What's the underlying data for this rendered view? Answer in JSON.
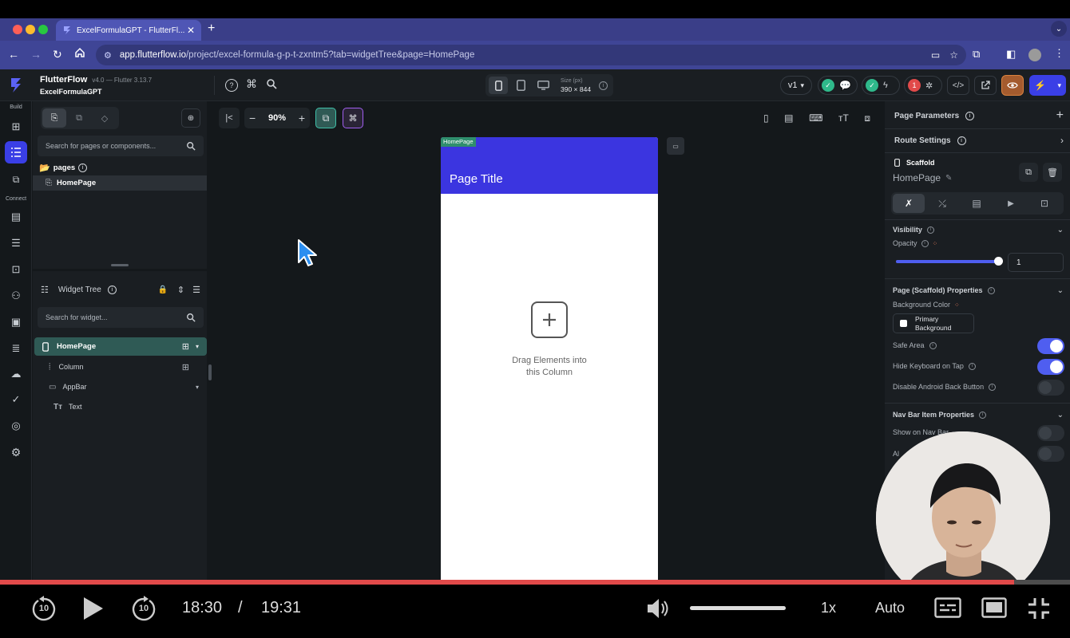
{
  "browser": {
    "tab_title": "ExcelFormulaGPT - FlutterFl...",
    "url_prefix": "app.flutterflow.io",
    "url_rest": "/project/excel-formula-g-p-t-zxntm5?tab=widgetTree&page=HomePage"
  },
  "header": {
    "app_name": "FlutterFlow",
    "version": "v4.0 — Flutter 3.13.7",
    "project": "ExcelFormulaGPT",
    "size_label": "Size (px)",
    "size_value": "390 × 844",
    "version_select": "v1",
    "error_count": "1"
  },
  "leftrail": {
    "build": "Build",
    "connect": "Connect"
  },
  "pages_panel": {
    "search_placeholder": "Search for pages or components...",
    "pages_label": "pages",
    "page_item": "HomePage"
  },
  "widget_tree": {
    "title": "Widget Tree",
    "search_placeholder": "Search for widget...",
    "nodes": [
      "HomePage",
      "Column",
      "AppBar",
      "Text"
    ]
  },
  "canvas": {
    "zoom": "90%",
    "page_tag": "HomePage",
    "page_title": "Page Title",
    "drag_text_line1": "Drag Elements into",
    "drag_text_line2": "this Column"
  },
  "props": {
    "page_parameters": "Page Parameters",
    "route_settings": "Route Settings",
    "scaffold": "Scaffold",
    "page_name": "HomePage",
    "visibility": "Visibility",
    "opacity": "Opacity",
    "opacity_value": "1",
    "opacity_level": 1,
    "scaffold_props": "Page (Scaffold) Properties",
    "bg_color_label": "Background Color",
    "bg_color_value_line1": "Primary",
    "bg_color_value_line2": "Background",
    "safe_area": "Safe Area",
    "hide_keyboard": "Hide Keyboard on Tap",
    "disable_back": "Disable Android Back Button",
    "navbar_props": "Nav Bar Item Properties",
    "show_on_nav": "Show on Nav Bar",
    "always": "Al"
  },
  "video": {
    "current_time": "18:30",
    "slash": "/",
    "total_time": "19:31",
    "speed": "1x",
    "quality": "Auto",
    "progress": 0.948,
    "volume": 1,
    "skip": "10"
  },
  "colors": {
    "accent": "#4f5ef0",
    "appbar": "#3b35e0",
    "progress": "#e14a4a"
  }
}
